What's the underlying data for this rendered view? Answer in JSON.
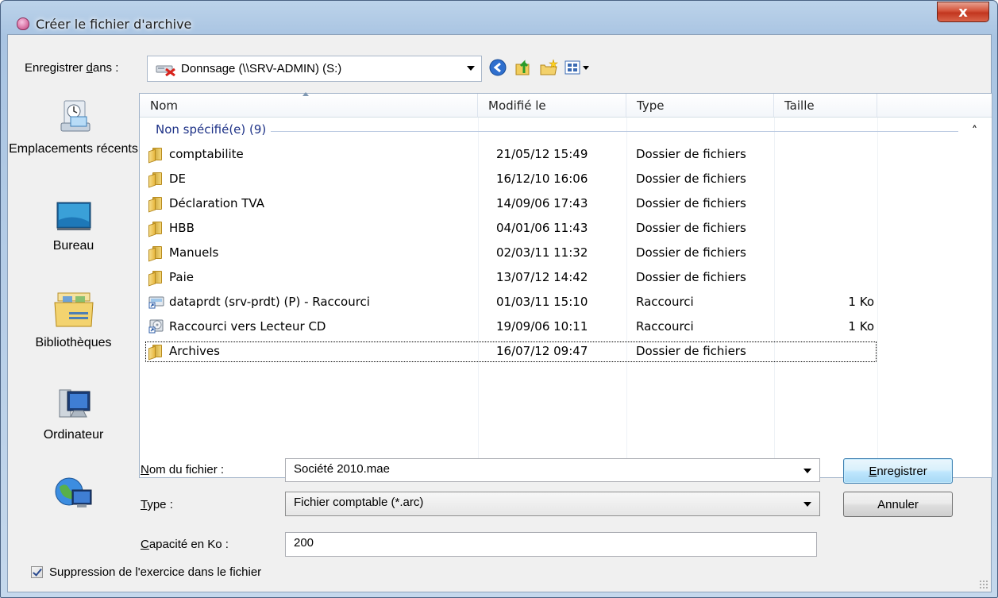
{
  "window": {
    "title": "Créer le fichier d'archive",
    "close_label": "x"
  },
  "location": {
    "label_prefix": "Enregistrer ",
    "label_underlined": "d",
    "label_suffix": "ans :",
    "value": "Donnsage (\\\\SRV-ADMIN) (S:)"
  },
  "places": [
    {
      "label": "Emplacements récents",
      "icon": "recent-places-icon"
    },
    {
      "label": "Bureau",
      "icon": "desktop-icon"
    },
    {
      "label": "Bibliothèques",
      "icon": "libraries-icon"
    },
    {
      "label": "Ordinateur",
      "icon": "computer-icon"
    },
    {
      "label": "",
      "icon": "network-icon"
    }
  ],
  "columns": {
    "name": "Nom",
    "modified": "Modifié le",
    "type": "Type",
    "size": "Taille"
  },
  "group": {
    "title": "Non spécifié(e) (9)"
  },
  "files": [
    {
      "name": "comptabilite",
      "modified": "21/05/12 15:49",
      "type": "Dossier de fichiers",
      "size": "",
      "icon": "folder-icon"
    },
    {
      "name": "DE",
      "modified": "16/12/10 16:06",
      "type": "Dossier de fichiers",
      "size": "",
      "icon": "folder-icon"
    },
    {
      "name": "Déclaration TVA",
      "modified": "14/09/06 17:43",
      "type": "Dossier de fichiers",
      "size": "",
      "icon": "folder-icon"
    },
    {
      "name": "HBB",
      "modified": "04/01/06 11:43",
      "type": "Dossier de fichiers",
      "size": "",
      "icon": "folder-icon"
    },
    {
      "name": "Manuels",
      "modified": "02/03/11 11:32",
      "type": "Dossier de fichiers",
      "size": "",
      "icon": "folder-icon"
    },
    {
      "name": "Paie",
      "modified": "13/07/12 14:42",
      "type": "Dossier de fichiers",
      "size": "",
      "icon": "folder-icon"
    },
    {
      "name": "dataprdt (srv-prdt) (P) - Raccourci",
      "modified": "01/03/11 15:10",
      "type": "Raccourci",
      "size": "1 Ko",
      "icon": "network-drive-shortcut-icon"
    },
    {
      "name": "Raccourci vers Lecteur CD",
      "modified": "19/09/06 10:11",
      "type": "Raccourci",
      "size": "1 Ko",
      "icon": "cd-drive-shortcut-icon"
    },
    {
      "name": "Archives",
      "modified": "16/07/12 09:47",
      "type": "Dossier de fichiers",
      "size": "",
      "icon": "folder-icon"
    }
  ],
  "form": {
    "filename": {
      "label_underlined": "N",
      "label_rest": "om du fichier :",
      "value": "Société 2010.mae"
    },
    "type": {
      "label_underlined": "T",
      "label_rest": "ype :",
      "value": "Fichier comptable (*.arc)"
    },
    "capacity": {
      "label_underlined": "C",
      "label_rest": "apacité en Ko :",
      "value": "200"
    }
  },
  "buttons": {
    "save_underlined": "E",
    "save_rest": "nregistrer",
    "cancel": "Annuler"
  },
  "checkbox": {
    "label": "Suppression de l'exercice dans le fichier",
    "checked": true
  },
  "colors": {
    "group_title": "#1e3287",
    "titlebar": "#a9c4e2",
    "close": "#c2361f"
  }
}
